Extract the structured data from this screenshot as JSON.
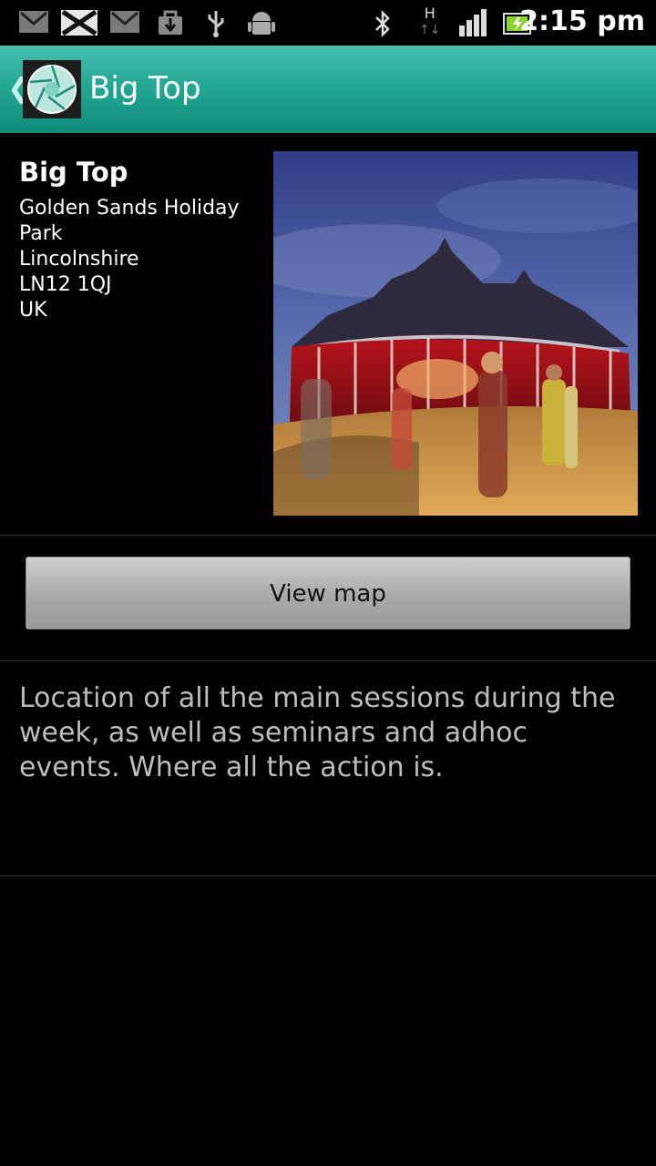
{
  "status_bar": {
    "time": "2:15 pm",
    "network_type": "H",
    "icons": [
      "gmail-icon",
      "missed-mail-icon",
      "gmail-icon",
      "download-icon",
      "usb-icon",
      "android-icon",
      "bluetooth-icon",
      "network-h-icon",
      "signal-icon",
      "battery-icon"
    ]
  },
  "action_bar": {
    "up_symbol": "❮",
    "title": "Big Top"
  },
  "venue": {
    "name": "Big Top",
    "address": [
      "Golden Sands Holiday",
      "Park",
      "Lincolnshire",
      "LN12 1QJ",
      "UK"
    ]
  },
  "map_button": {
    "label": "View map"
  },
  "description": "Location of all the main sessions during the week, as well as seminars and adhoc events. Where all the action is.",
  "colors": {
    "accent": "#23a893",
    "background": "#000000",
    "description_text": "#bdbdbd"
  }
}
